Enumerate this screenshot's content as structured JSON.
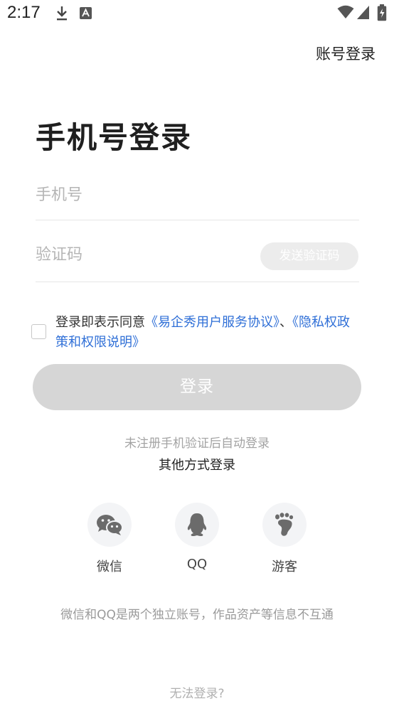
{
  "status_bar": {
    "time": "2:17",
    "icons": [
      "download-icon",
      "app-notification-icon",
      "wifi-icon",
      "signal-icon",
      "battery-icon"
    ]
  },
  "header": {
    "account_login": "账号登录"
  },
  "page": {
    "title": "手机号登录"
  },
  "form": {
    "phone_placeholder": "手机号",
    "code_placeholder": "验证码",
    "send_code_label": "发送验证码",
    "agreement_prefix": "登录即表示同意",
    "user_agreement_link": "《易企秀用户服务协议》",
    "separator": "、",
    "privacy_link": "《隐私权政策和权限说明》",
    "login_button": "登录",
    "auto_register_hint": "未注册手机验证后自动登录"
  },
  "other_login": {
    "title": "其他方式登录",
    "options": [
      {
        "label": "微信",
        "icon": "wechat-icon"
      },
      {
        "label": "QQ",
        "icon": "qq-icon"
      },
      {
        "label": "游客",
        "icon": "footprint-icon"
      }
    ],
    "note": "微信和QQ是两个独立账号，作品资产等信息不互通"
  },
  "footer": {
    "cannot_login": "无法登录?"
  },
  "colors": {
    "link": "#2f6fd7",
    "button_disabled": "#d6d6d6",
    "icon_gray": "#6b6b6b"
  }
}
